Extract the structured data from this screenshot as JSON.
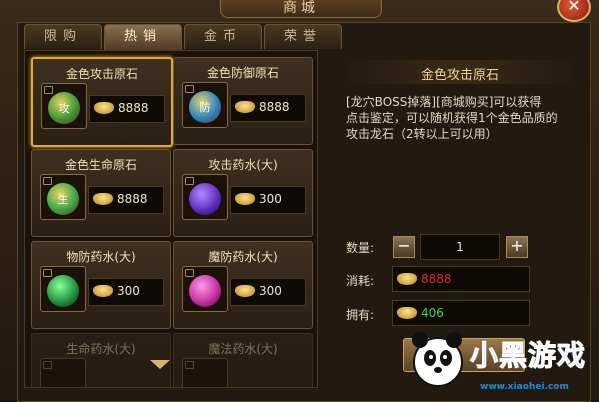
{
  "window": {
    "title": "商城",
    "close_icon": "close-icon"
  },
  "tabs": [
    {
      "label": "限购",
      "active": false
    },
    {
      "label": "热销",
      "active": true
    },
    {
      "label": "金币",
      "active": false
    },
    {
      "label": "荣誉",
      "active": false
    }
  ],
  "items": [
    {
      "name": "金色攻击原石",
      "price": "8888",
      "icon": "gold-attack-stone-icon",
      "color": "#3a9a3a",
      "glyph": "攻",
      "selected": true
    },
    {
      "name": "金色防御原石",
      "price": "8888",
      "icon": "gold-defense-stone-icon",
      "color": "#2a88c8",
      "glyph": "防",
      "selected": false
    },
    {
      "name": "金色生命原石",
      "price": "8888",
      "icon": "gold-life-stone-icon",
      "color": "#3aa84a",
      "glyph": "生",
      "selected": false
    },
    {
      "name": "攻击药水(大)",
      "price": "300",
      "icon": "attack-potion-icon",
      "color": "#5a2ab8",
      "glyph": "",
      "selected": false
    },
    {
      "name": "物防药水(大)",
      "price": "300",
      "icon": "physical-defense-potion-icon",
      "color": "#1f8a3a",
      "glyph": "",
      "selected": false
    },
    {
      "name": "魔防药水(大)",
      "price": "300",
      "icon": "magic-defense-potion-icon",
      "color": "#c02a9a",
      "glyph": "",
      "selected": false
    },
    {
      "name": "生命药水(大)",
      "price": "",
      "icon": "life-potion-icon",
      "color": "#6a5030",
      "glyph": "",
      "selected": false
    },
    {
      "name": "魔法药水(大)",
      "price": "",
      "icon": "mana-potion-icon",
      "color": "#6a5030",
      "glyph": "",
      "selected": false
    }
  ],
  "detail": {
    "title": "金色攻击原石",
    "description_lines": [
      "[龙穴BOSS掉落][商城购买]可以获得",
      "点击鉴定，可以随机获得1个金色品质的",
      "攻击龙石（2转以上可以用）"
    ],
    "quantity_label": "数量:",
    "quantity_value": "1",
    "cost_label": "消耗:",
    "cost_value": "8888",
    "cost_color": "#e02a2a",
    "owned_label": "拥有:",
    "owned_value": "406",
    "owned_color": "#3ad84a"
  },
  "watermark": {
    "text": "小黑游戏",
    "url": "www.xiaohei.com"
  }
}
